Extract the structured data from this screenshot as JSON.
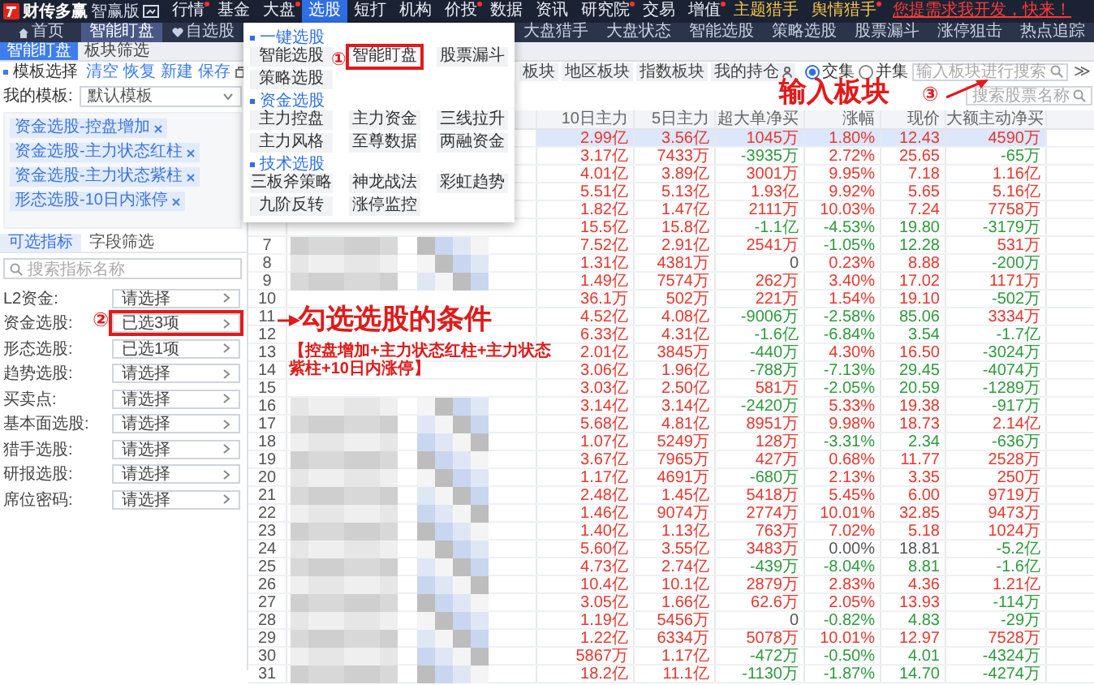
{
  "app": {
    "name": "财传多赢",
    "edition": "智赢版"
  },
  "menu": [
    {
      "label": "行情",
      "kind": "normal",
      "dot": true,
      "selected": false
    },
    {
      "label": "基金",
      "kind": "normal",
      "dot": false,
      "selected": false
    },
    {
      "label": "大盘",
      "kind": "normal",
      "dot": true,
      "selected": false
    },
    {
      "label": "选股",
      "kind": "normal",
      "dot": false,
      "selected": true
    },
    {
      "label": "短打",
      "kind": "normal",
      "dot": false,
      "selected": false
    },
    {
      "label": "机构",
      "kind": "normal",
      "dot": false,
      "selected": false
    },
    {
      "label": "价投",
      "kind": "normal",
      "dot": true,
      "selected": false
    },
    {
      "label": "数据",
      "kind": "normal",
      "dot": false,
      "selected": false
    },
    {
      "label": "资讯",
      "kind": "normal",
      "dot": false,
      "selected": false
    },
    {
      "label": "研究院",
      "kind": "normal",
      "dot": true,
      "selected": false
    },
    {
      "label": "交易",
      "kind": "normal",
      "dot": false,
      "selected": false
    },
    {
      "label": "增值",
      "kind": "normal",
      "dot": true,
      "selected": false
    },
    {
      "label": "主题猎手",
      "kind": "hunter",
      "dot": false,
      "selected": false
    },
    {
      "label": "舆情猎手",
      "kind": "hunter",
      "dot": true,
      "selected": false
    },
    {
      "label": "您提需求我开发，快来！",
      "kind": "promo",
      "dot": false,
      "selected": false
    }
  ],
  "page_tabs": [
    {
      "label": "首页",
      "kind": "home",
      "selected": false
    },
    {
      "label": "智能盯盘",
      "kind": "plain",
      "selected": true
    },
    {
      "label": "自选股",
      "kind": "favorites",
      "selected": false
    },
    {
      "label": "大盘猎手",
      "kind": "plain",
      "selected": false
    },
    {
      "label": "大盘状态",
      "kind": "plain",
      "selected": false
    },
    {
      "label": "智能选股",
      "kind": "plain",
      "selected": false
    },
    {
      "label": "策略选股",
      "kind": "plain",
      "selected": false
    },
    {
      "label": "股票漏斗",
      "kind": "plain",
      "selected": false
    },
    {
      "label": "涨停狙击",
      "kind": "plain",
      "selected": false
    },
    {
      "label": "热点追踪",
      "kind": "plain",
      "selected": false
    }
  ],
  "sub_tabs": [
    {
      "label": "智能盯盘",
      "selected": true
    },
    {
      "label": "板块筛选",
      "selected": false
    }
  ],
  "template_panel": {
    "title": "模板选择",
    "actions": [
      "清空",
      "恢复",
      "新建",
      "保存"
    ],
    "template_label": "我的模板:",
    "template_value": "默认模板",
    "tags": [
      "资金选股-控盘增加",
      "资金选股-主力状态红柱",
      "资金选股-主力状态紫柱",
      "形态选股-10日内涨停"
    ],
    "tabs": [
      {
        "label": "可选指标",
        "selected": true
      },
      {
        "label": "字段筛选",
        "selected": false
      }
    ],
    "search": {
      "placeholder": "搜索指标名称"
    },
    "filters": [
      {
        "label": "L2资金:",
        "value": "请选择",
        "highlighted": false
      },
      {
        "label": "资金选股:",
        "value": "已选3项",
        "highlighted": true
      },
      {
        "label": "形态选股:",
        "value": "已选1项",
        "highlighted": false
      },
      {
        "label": "趋势选股:",
        "value": "请选择",
        "highlighted": false
      },
      {
        "label": "买卖点:",
        "value": "请选择",
        "highlighted": false
      },
      {
        "label": "基本面选股:",
        "value": "请选择",
        "highlighted": false
      },
      {
        "label": "猎手选股:",
        "value": "请选择",
        "highlighted": false
      },
      {
        "label": "研报选股:",
        "value": "请选择",
        "highlighted": false
      },
      {
        "label": "席位密码:",
        "value": "请选择",
        "highlighted": false
      }
    ]
  },
  "board_buttons": [
    "板块",
    "地区板块",
    "指数板块",
    "我的持仓"
  ],
  "set_mode": [
    {
      "label": "交集",
      "selected": true
    },
    {
      "label": "并集",
      "selected": false
    }
  ],
  "board_search": {
    "placeholder": "输入板块进行搜索"
  },
  "expand_button": "≫",
  "stock_search": {
    "placeholder": "搜索股票名称"
  },
  "table": {
    "columns": [
      "10日主力",
      "5日主力",
      "超大单净买",
      "涨幅",
      "现价",
      "大额主动净买"
    ],
    "rows": [
      {
        "selected": true,
        "cells": [
          {
            "text": "2.99亿",
            "color": "#e8372f"
          },
          {
            "text": "3.56亿",
            "color": "#e8372f"
          },
          {
            "text": "1045万",
            "color": "#e8372f"
          },
          {
            "text": "1.80%",
            "color": "#e8372f"
          },
          {
            "text": "12.43",
            "color": "#e8372f"
          },
          {
            "text": "4590万",
            "color": "#e8372f"
          }
        ]
      },
      {
        "selected": false,
        "cells": [
          {
            "text": "3.17亿",
            "color": "#e8372f"
          },
          {
            "text": "7433万",
            "color": "#e8372f"
          },
          {
            "text": "-3935万",
            "color": "#2f9a3e"
          },
          {
            "text": "2.72%",
            "color": "#e8372f"
          },
          {
            "text": "25.65",
            "color": "#e8372f"
          },
          {
            "text": "-65万",
            "color": "#2f9a3e"
          }
        ]
      },
      {
        "selected": false,
        "cells": [
          {
            "text": "4.01亿",
            "color": "#e8372f"
          },
          {
            "text": "3.89亿",
            "color": "#e8372f"
          },
          {
            "text": "3001万",
            "color": "#e8372f"
          },
          {
            "text": "9.95%",
            "color": "#e8372f"
          },
          {
            "text": "7.18",
            "color": "#e8372f"
          },
          {
            "text": "1.16亿",
            "color": "#e8372f"
          }
        ]
      },
      {
        "selected": false,
        "cells": [
          {
            "text": "5.51亿",
            "color": "#e8372f"
          },
          {
            "text": "5.13亿",
            "color": "#e8372f"
          },
          {
            "text": "1.93亿",
            "color": "#e8372f"
          },
          {
            "text": "9.92%",
            "color": "#e8372f"
          },
          {
            "text": "5.65",
            "color": "#e8372f"
          },
          {
            "text": "5.16亿",
            "color": "#e8372f"
          }
        ]
      },
      {
        "selected": false,
        "cells": [
          {
            "text": "1.82亿",
            "color": "#e8372f"
          },
          {
            "text": "1.47亿",
            "color": "#e8372f"
          },
          {
            "text": "2111万",
            "color": "#e8372f"
          },
          {
            "text": "10.03%",
            "color": "#e8372f"
          },
          {
            "text": "7.24",
            "color": "#e8372f"
          },
          {
            "text": "7758万",
            "color": "#e8372f"
          }
        ]
      },
      {
        "selected": false,
        "cells": [
          {
            "text": "15.5亿",
            "color": "#e8372f"
          },
          {
            "text": "15.8亿",
            "color": "#e8372f"
          },
          {
            "text": "-1.1亿",
            "color": "#2f9a3e"
          },
          {
            "text": "-4.53%",
            "color": "#2f9a3e"
          },
          {
            "text": "19.80",
            "color": "#2f9a3e"
          },
          {
            "text": "-3179万",
            "color": "#2f9a3e"
          }
        ]
      },
      {
        "no": "7",
        "selected": false,
        "cells": [
          {
            "text": "7.52亿",
            "color": "#e8372f"
          },
          {
            "text": "2.91亿",
            "color": "#e8372f"
          },
          {
            "text": "2541万",
            "color": "#e8372f"
          },
          {
            "text": "-1.05%",
            "color": "#2f9a3e"
          },
          {
            "text": "12.28",
            "color": "#2f9a3e"
          },
          {
            "text": "531万",
            "color": "#e8372f"
          }
        ]
      },
      {
        "no": "8",
        "selected": false,
        "cells": [
          {
            "text": "1.31亿",
            "color": "#e8372f"
          },
          {
            "text": "4381万",
            "color": "#e8372f"
          },
          {
            "text": "0",
            "color": "#555555"
          },
          {
            "text": "0.23%",
            "color": "#e8372f"
          },
          {
            "text": "8.88",
            "color": "#e8372f"
          },
          {
            "text": "-200万",
            "color": "#2f9a3e"
          }
        ]
      },
      {
        "no": "9",
        "selected": false,
        "cells": [
          {
            "text": "1.49亿",
            "color": "#e8372f"
          },
          {
            "text": "7574万",
            "color": "#e8372f"
          },
          {
            "text": "262万",
            "color": "#e8372f"
          },
          {
            "text": "3.40%",
            "color": "#e8372f"
          },
          {
            "text": "17.02",
            "color": "#e8372f"
          },
          {
            "text": "1171万",
            "color": "#e8372f"
          }
        ]
      },
      {
        "no": "10",
        "selected": false,
        "cells": [
          {
            "text": "36.1万",
            "color": "#e8372f"
          },
          {
            "text": "502万",
            "color": "#e8372f"
          },
          {
            "text": "221万",
            "color": "#e8372f"
          },
          {
            "text": "1.54%",
            "color": "#e8372f"
          },
          {
            "text": "19.10",
            "color": "#e8372f"
          },
          {
            "text": "-502万",
            "color": "#2f9a3e"
          }
        ]
      },
      {
        "no": "11",
        "selected": false,
        "cells": [
          {
            "text": "4.52亿",
            "color": "#e8372f"
          },
          {
            "text": "4.08亿",
            "color": "#e8372f"
          },
          {
            "text": "-9006万",
            "color": "#2f9a3e"
          },
          {
            "text": "-2.58%",
            "color": "#2f9a3e"
          },
          {
            "text": "85.06",
            "color": "#2f9a3e"
          },
          {
            "text": "3334万",
            "color": "#e8372f"
          }
        ]
      },
      {
        "no": "12",
        "selected": false,
        "cells": [
          {
            "text": "6.33亿",
            "color": "#e8372f"
          },
          {
            "text": "4.31亿",
            "color": "#e8372f"
          },
          {
            "text": "-1.6亿",
            "color": "#2f9a3e"
          },
          {
            "text": "-6.84%",
            "color": "#2f9a3e"
          },
          {
            "text": "3.54",
            "color": "#2f9a3e"
          },
          {
            "text": "-1.7亿",
            "color": "#2f9a3e"
          }
        ]
      },
      {
        "no": "13",
        "selected": false,
        "cells": [
          {
            "text": "2.01亿",
            "color": "#e8372f"
          },
          {
            "text": "3845万",
            "color": "#e8372f"
          },
          {
            "text": "-440万",
            "color": "#2f9a3e"
          },
          {
            "text": "4.30%",
            "color": "#e8372f"
          },
          {
            "text": "16.50",
            "color": "#e8372f"
          },
          {
            "text": "-3024万",
            "color": "#2f9a3e"
          }
        ]
      },
      {
        "no": "14",
        "selected": false,
        "cells": [
          {
            "text": "3.06亿",
            "color": "#e8372f"
          },
          {
            "text": "1.96亿",
            "color": "#e8372f"
          },
          {
            "text": "-788万",
            "color": "#2f9a3e"
          },
          {
            "text": "-7.13%",
            "color": "#2f9a3e"
          },
          {
            "text": "29.45",
            "color": "#2f9a3e"
          },
          {
            "text": "-4074万",
            "color": "#2f9a3e"
          }
        ]
      },
      {
        "no": "15",
        "selected": false,
        "cells": [
          {
            "text": "3.03亿",
            "color": "#e8372f"
          },
          {
            "text": "2.50亿",
            "color": "#e8372f"
          },
          {
            "text": "581万",
            "color": "#e8372f"
          },
          {
            "text": "-2.05%",
            "color": "#2f9a3e"
          },
          {
            "text": "20.59",
            "color": "#2f9a3e"
          },
          {
            "text": "-1289万",
            "color": "#2f9a3e"
          }
        ]
      },
      {
        "no": "16",
        "selected": false,
        "cells": [
          {
            "text": "3.14亿",
            "color": "#e8372f"
          },
          {
            "text": "3.14亿",
            "color": "#e8372f"
          },
          {
            "text": "-2420万",
            "color": "#2f9a3e"
          },
          {
            "text": "5.33%",
            "color": "#e8372f"
          },
          {
            "text": "19.38",
            "color": "#e8372f"
          },
          {
            "text": "-917万",
            "color": "#2f9a3e"
          }
        ]
      },
      {
        "no": "17",
        "selected": false,
        "cells": [
          {
            "text": "5.68亿",
            "color": "#e8372f"
          },
          {
            "text": "4.81亿",
            "color": "#e8372f"
          },
          {
            "text": "8951万",
            "color": "#e8372f"
          },
          {
            "text": "9.98%",
            "color": "#e8372f"
          },
          {
            "text": "18.73",
            "color": "#e8372f"
          },
          {
            "text": "2.14亿",
            "color": "#e8372f"
          }
        ]
      },
      {
        "no": "18",
        "selected": false,
        "cells": [
          {
            "text": "1.07亿",
            "color": "#e8372f"
          },
          {
            "text": "5249万",
            "color": "#e8372f"
          },
          {
            "text": "128万",
            "color": "#e8372f"
          },
          {
            "text": "-3.31%",
            "color": "#2f9a3e"
          },
          {
            "text": "2.34",
            "color": "#2f9a3e"
          },
          {
            "text": "-636万",
            "color": "#2f9a3e"
          }
        ]
      },
      {
        "no": "19",
        "selected": false,
        "cells": [
          {
            "text": "3.67亿",
            "color": "#e8372f"
          },
          {
            "text": "7965万",
            "color": "#e8372f"
          },
          {
            "text": "427万",
            "color": "#e8372f"
          },
          {
            "text": "0.68%",
            "color": "#e8372f"
          },
          {
            "text": "11.77",
            "color": "#e8372f"
          },
          {
            "text": "2528万",
            "color": "#e8372f"
          }
        ]
      },
      {
        "no": "20",
        "selected": false,
        "cells": [
          {
            "text": "1.17亿",
            "color": "#e8372f"
          },
          {
            "text": "4691万",
            "color": "#e8372f"
          },
          {
            "text": "-680万",
            "color": "#2f9a3e"
          },
          {
            "text": "2.13%",
            "color": "#e8372f"
          },
          {
            "text": "3.35",
            "color": "#e8372f"
          },
          {
            "text": "250万",
            "color": "#e8372f"
          }
        ]
      },
      {
        "no": "21",
        "selected": false,
        "cells": [
          {
            "text": "2.48亿",
            "color": "#e8372f"
          },
          {
            "text": "1.45亿",
            "color": "#e8372f"
          },
          {
            "text": "5418万",
            "color": "#e8372f"
          },
          {
            "text": "5.45%",
            "color": "#e8372f"
          },
          {
            "text": "6.00",
            "color": "#e8372f"
          },
          {
            "text": "9719万",
            "color": "#e8372f"
          }
        ]
      },
      {
        "no": "22",
        "selected": false,
        "cells": [
          {
            "text": "1.46亿",
            "color": "#e8372f"
          },
          {
            "text": "9074万",
            "color": "#e8372f"
          },
          {
            "text": "2774万",
            "color": "#e8372f"
          },
          {
            "text": "10.01%",
            "color": "#e8372f"
          },
          {
            "text": "32.85",
            "color": "#e8372f"
          },
          {
            "text": "9473万",
            "color": "#e8372f"
          }
        ]
      },
      {
        "no": "23",
        "selected": false,
        "cells": [
          {
            "text": "1.40亿",
            "color": "#e8372f"
          },
          {
            "text": "1.13亿",
            "color": "#e8372f"
          },
          {
            "text": "763万",
            "color": "#e8372f"
          },
          {
            "text": "7.02%",
            "color": "#e8372f"
          },
          {
            "text": "5.18",
            "color": "#e8372f"
          },
          {
            "text": "1024万",
            "color": "#e8372f"
          }
        ]
      },
      {
        "no": "24",
        "selected": false,
        "cells": [
          {
            "text": "5.60亿",
            "color": "#e8372f"
          },
          {
            "text": "3.55亿",
            "color": "#e8372f"
          },
          {
            "text": "3483万",
            "color": "#e8372f"
          },
          {
            "text": "0.00%",
            "color": "#555555"
          },
          {
            "text": "18.81",
            "color": "#555555"
          },
          {
            "text": "-5.2亿",
            "color": "#2f9a3e"
          }
        ]
      },
      {
        "no": "25",
        "selected": false,
        "cells": [
          {
            "text": "4.73亿",
            "color": "#e8372f"
          },
          {
            "text": "2.74亿",
            "color": "#e8372f"
          },
          {
            "text": "-439万",
            "color": "#2f9a3e"
          },
          {
            "text": "-8.04%",
            "color": "#2f9a3e"
          },
          {
            "text": "8.81",
            "color": "#2f9a3e"
          },
          {
            "text": "-1.6亿",
            "color": "#2f9a3e"
          }
        ]
      },
      {
        "no": "26",
        "selected": false,
        "cells": [
          {
            "text": "10.4亿",
            "color": "#e8372f"
          },
          {
            "text": "10.1亿",
            "color": "#e8372f"
          },
          {
            "text": "2879万",
            "color": "#e8372f"
          },
          {
            "text": "2.83%",
            "color": "#e8372f"
          },
          {
            "text": "4.36",
            "color": "#e8372f"
          },
          {
            "text": "1.21亿",
            "color": "#e8372f"
          }
        ]
      },
      {
        "no": "27",
        "selected": false,
        "cells": [
          {
            "text": "3.05亿",
            "color": "#e8372f"
          },
          {
            "text": "1.66亿",
            "color": "#e8372f"
          },
          {
            "text": "62.6万",
            "color": "#e8372f"
          },
          {
            "text": "2.05%",
            "color": "#e8372f"
          },
          {
            "text": "13.93",
            "color": "#e8372f"
          },
          {
            "text": "-114万",
            "color": "#2f9a3e"
          }
        ]
      },
      {
        "no": "28",
        "selected": false,
        "cells": [
          {
            "text": "1.19亿",
            "color": "#e8372f"
          },
          {
            "text": "5456万",
            "color": "#e8372f"
          },
          {
            "text": "0",
            "color": "#555555"
          },
          {
            "text": "-0.82%",
            "color": "#2f9a3e"
          },
          {
            "text": "4.83",
            "color": "#2f9a3e"
          },
          {
            "text": "-29万",
            "color": "#2f9a3e"
          }
        ]
      },
      {
        "no": "29",
        "selected": false,
        "cells": [
          {
            "text": "1.22亿",
            "color": "#e8372f"
          },
          {
            "text": "6334万",
            "color": "#e8372f"
          },
          {
            "text": "5078万",
            "color": "#e8372f"
          },
          {
            "text": "10.01%",
            "color": "#e8372f"
          },
          {
            "text": "12.97",
            "color": "#e8372f"
          },
          {
            "text": "7528万",
            "color": "#e8372f"
          }
        ]
      },
      {
        "no": "30",
        "selected": false,
        "cells": [
          {
            "text": "5867万",
            "color": "#e8372f"
          },
          {
            "text": "1.17亿",
            "color": "#e8372f"
          },
          {
            "text": "-472万",
            "color": "#2f9a3e"
          },
          {
            "text": "-0.50%",
            "color": "#2f9a3e"
          },
          {
            "text": "4.01",
            "color": "#2f9a3e"
          },
          {
            "text": "-4324万",
            "color": "#2f9a3e"
          }
        ]
      },
      {
        "no": "31",
        "selected": false,
        "cells": [
          {
            "text": "18.2亿",
            "color": "#e8372f"
          },
          {
            "text": "11.1亿",
            "color": "#e8372f"
          },
          {
            "text": "-1130万",
            "color": "#2f9a3e"
          },
          {
            "text": "-1.87%",
            "color": "#2f9a3e"
          },
          {
            "text": "14.70",
            "color": "#2f9a3e"
          },
          {
            "text": "-4274万",
            "color": "#2f9a3e"
          }
        ]
      }
    ]
  },
  "select_menu": {
    "sections": [
      {
        "title": "一键选股",
        "items": [
          {
            "label": "智能选股",
            "highlighted": false
          },
          {
            "label": "智能盯盘",
            "highlighted": true
          },
          {
            "label": "股票漏斗",
            "highlighted": false
          },
          {
            "label": "策略选股",
            "highlighted": false
          }
        ]
      },
      {
        "title": "资金选股",
        "items": [
          {
            "label": "主力控盘",
            "highlighted": false
          },
          {
            "label": "主力资金",
            "highlighted": false
          },
          {
            "label": "三线拉升",
            "highlighted": false
          },
          {
            "label": "主力风格",
            "highlighted": false
          },
          {
            "label": "至尊数据",
            "highlighted": false
          },
          {
            "label": "两融资金",
            "highlighted": false
          }
        ]
      },
      {
        "title": "技术选股",
        "items": [
          {
            "label": "三板斧策略",
            "highlighted": false
          },
          {
            "label": "神龙战法",
            "highlighted": false
          },
          {
            "label": "彩虹趋势",
            "highlighted": false
          },
          {
            "label": "九阶反转",
            "highlighted": false
          },
          {
            "label": "涨停监控",
            "highlighted": false
          }
        ]
      }
    ]
  },
  "annotations": {
    "step_1": "①",
    "step_2": "②",
    "step_3": "③",
    "search_hint": "输入板块",
    "condition_hint": "勾选选股的条件",
    "condition_detail": "【控盘增加+主力状态红柱+主力状态紫柱+10日内涨停】"
  }
}
